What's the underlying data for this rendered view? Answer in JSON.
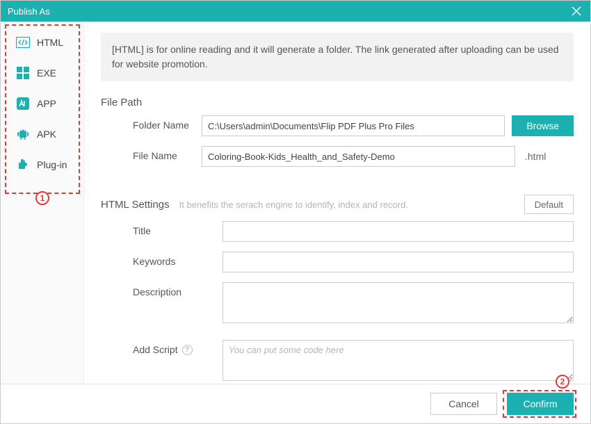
{
  "titlebar": {
    "title": "Publish As"
  },
  "sidebar": {
    "items": [
      {
        "label": "HTML"
      },
      {
        "label": "EXE"
      },
      {
        "label": "APP"
      },
      {
        "label": "APK"
      },
      {
        "label": "Plug-in"
      }
    ]
  },
  "info_banner": "[HTML] is for online reading and it will generate a folder. The link generated after uploading can be used for website promotion.",
  "filepath": {
    "section_title": "File Path",
    "folder_label": "Folder Name",
    "folder_value": "C:\\Users\\admin\\Documents\\Flip PDF Plus Pro Files",
    "browse_label": "Browse",
    "file_label": "File Name",
    "file_value": "Coloring-Book-Kids_Health_and_Safety-Demo",
    "file_ext": ".html"
  },
  "settings": {
    "section_title": "HTML Settings",
    "hint": "It benefits the serach engine to identify, index and record.",
    "default_label": "Default",
    "title_label": "Title",
    "title_value": "",
    "keywords_label": "Keywords",
    "keywords_value": "",
    "description_label": "Description",
    "description_value": "",
    "script_label": "Add Script",
    "script_placeholder": "You can put some code here",
    "script_value": ""
  },
  "footer": {
    "cancel_label": "Cancel",
    "confirm_label": "Confirm"
  },
  "annotations": {
    "badge1": "1",
    "badge2": "2"
  }
}
